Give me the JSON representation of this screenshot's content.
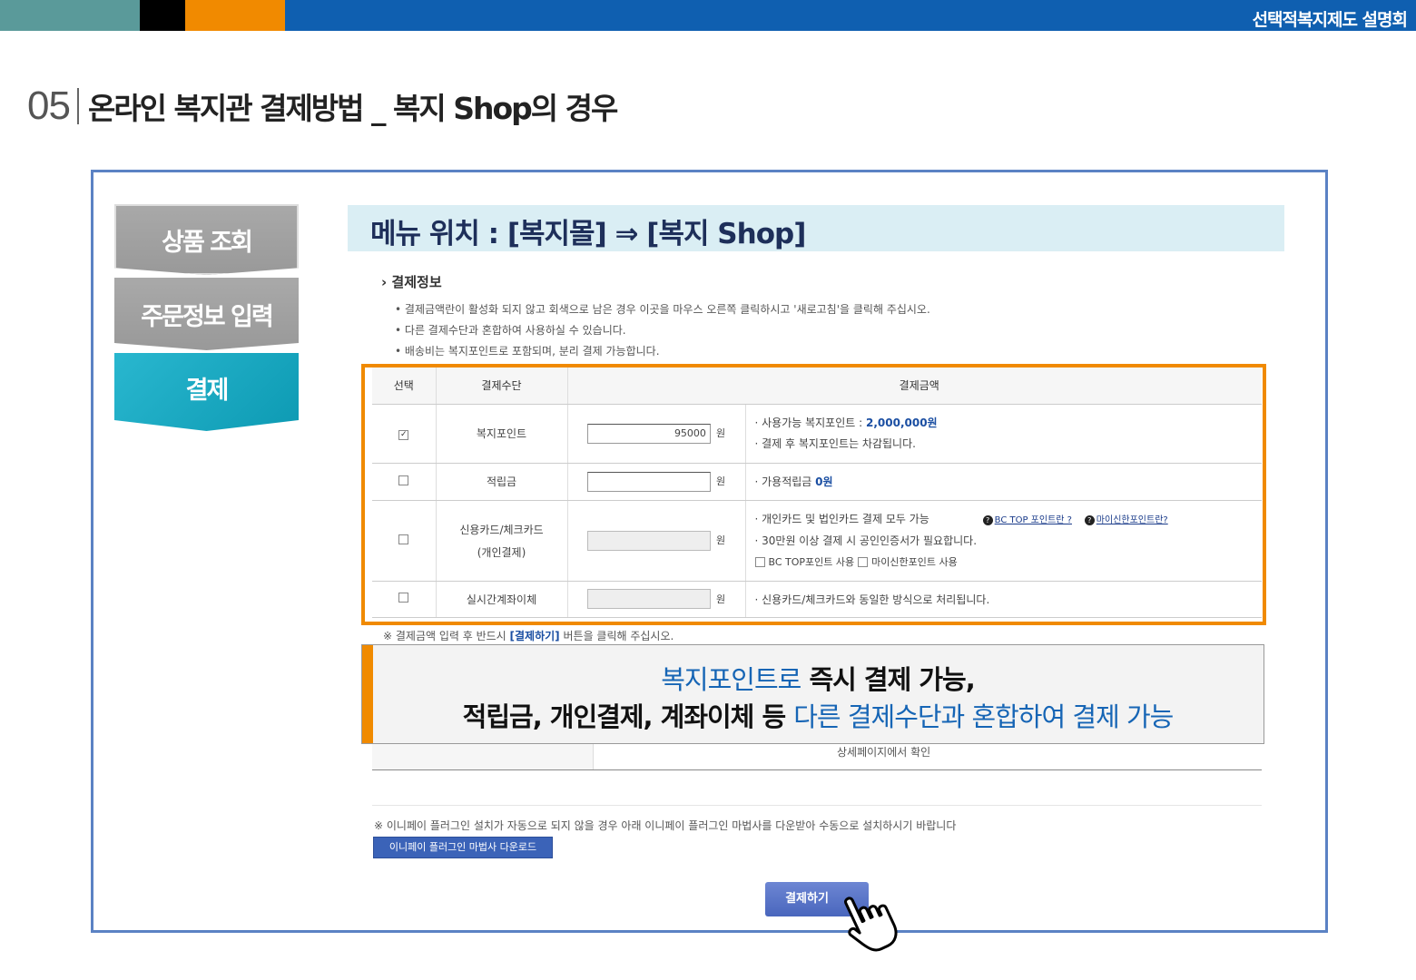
{
  "header": {
    "brand": "선택적복지제도 설명회"
  },
  "section": {
    "number": "05",
    "title": "온라인 복지관 결제방법 _ 복지 Shop의 경우"
  },
  "steps": [
    {
      "label": "상품 조회",
      "state": "inactive"
    },
    {
      "label": "주문정보 입력",
      "state": "inactive"
    },
    {
      "label": "결제",
      "state": "active"
    }
  ],
  "menu_location": "메뉴 위치 : [복지몰] ⇒ [복지 Shop]",
  "payment_info": {
    "title": "결제정보",
    "notes": [
      "결제금액란이 활성화 되지 않고 회색으로 남은 경우 이곳을 마우스 오른쪽 클릭하시고 '새로고침'을 클릭해 주십시오.",
      "다른 결제수단과 혼합하여 사용하실 수 있습니다.",
      "배송비는 복지포인트로 포함되며, 분리 결제 가능합니다."
    ],
    "columns": [
      "선택",
      "결제수단",
      "결제금액"
    ],
    "currency_unit": "원",
    "rows": [
      {
        "method": "복지포인트",
        "checked": true,
        "amount": "95000",
        "info_lines": [
          "· 사용가능 복지포인트 : ",
          "· 결제 후 복지포인트는 차감됩니다."
        ],
        "available_points": "2,000,000원"
      },
      {
        "method": "적립금",
        "checked": false,
        "amount": "",
        "info_prefix": "· 가용적립금 ",
        "info_value": "0원"
      },
      {
        "method": "신용카드/체크카드",
        "method_sub": "(개인결제)",
        "checked": false,
        "amount": "",
        "info_lines": [
          "· 개인카드 및 법인카드 결제 모두 가능",
          "· 30만원 이상 결제 시 공인인증서가 필요합니다."
        ],
        "help_links": [
          "BC TOP 포인트란 ?",
          "마이신한포인트란?"
        ],
        "sub_options": [
          "BC TOP포인트 사용",
          "마이신한포인트 사용"
        ]
      },
      {
        "method": "실시간계좌이체",
        "checked": false,
        "amount": "",
        "info_lines": [
          "· 신용카드/체크카드와 동일한 방식으로 처리됩니다."
        ]
      }
    ],
    "remark_prefix": "※ 결제금액 입력 후 반드시 ",
    "remark_button": "[결제하기]",
    "remark_suffix": " 버튼을 클릭해 주십시오."
  },
  "callout": {
    "line1_blue": "복지포인트로",
    "line1_black": " 즉시 결제 가능,",
    "line2_black": "적립금, 개인결제, 계좌이체 등 ",
    "line2_blue": "다른 결제수단과 혼합하여 결제 가능"
  },
  "below_row_text": "상세페이지에서 확인",
  "inipay": {
    "note": "※ 이니페이 플러그인 설치가 자동으로 되지 않을 경우 아래 이니페이 플러그인 마법사를 다운받아 수동으로 설치하시기 바랍니다",
    "download_button": "이니페이 플러그인 마법사 다운로드"
  },
  "pay_button": "결제하기",
  "colors": {
    "accent_orange": "#f08a00",
    "brand_blue": "#0f5fb0",
    "active_step": "#1aa8c1",
    "frame_border": "#5b82c4"
  },
  "icons": {
    "checkbox_checked": "✓",
    "help": "?",
    "cursor": "hand-pointer-icon"
  }
}
